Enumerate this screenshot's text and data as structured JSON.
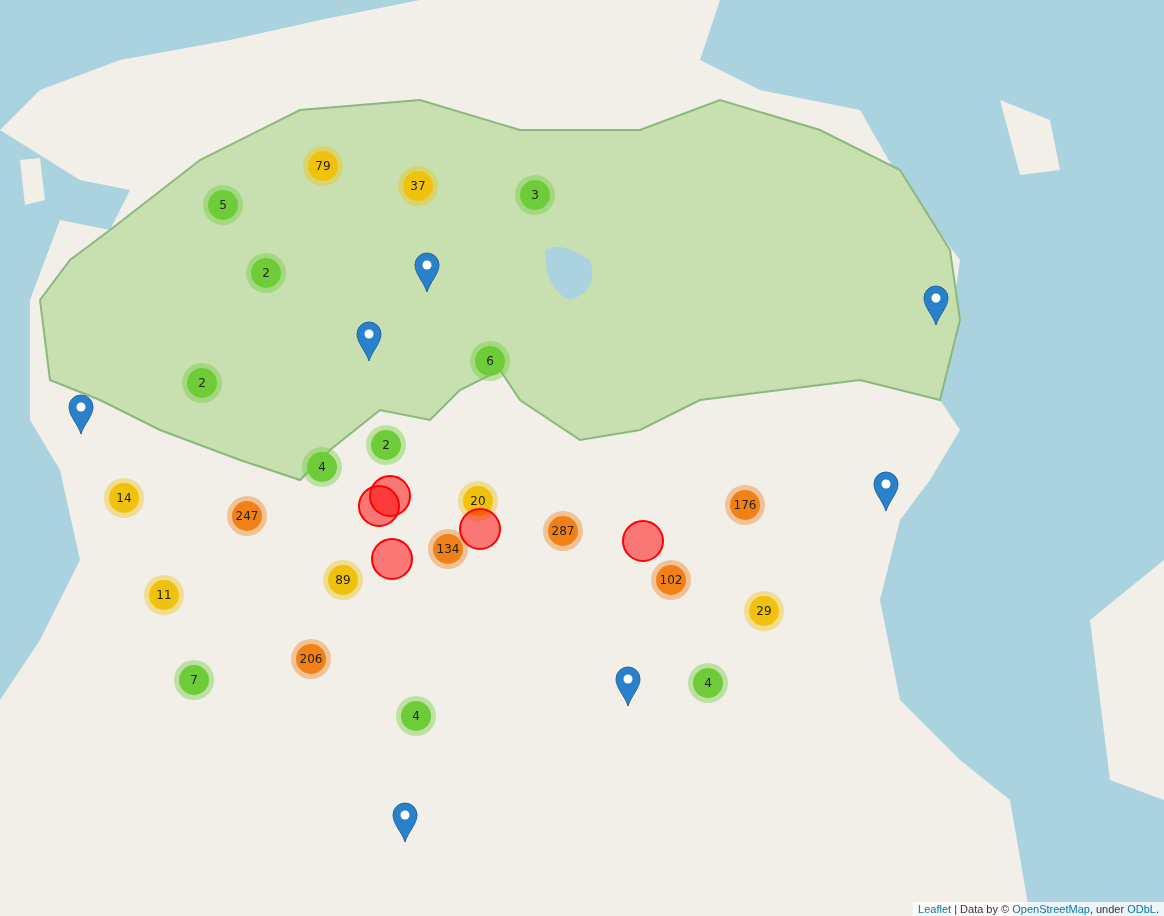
{
  "map": {
    "clusters": [
      {
        "count": "79",
        "color": "#f0c20c"
      },
      {
        "count": "37",
        "color": "#f0c20c"
      },
      {
        "count": "3",
        "color": "#6ecc39"
      },
      {
        "count": "5",
        "color": "#6ecc39"
      },
      {
        "count": "2",
        "color": "#6ecc39"
      },
      {
        "count": "6",
        "color": "#6ecc39"
      },
      {
        "count": "2",
        "color": "#6ecc39"
      },
      {
        "count": "2",
        "color": "#6ecc39"
      },
      {
        "count": "4",
        "color": "#6ecc39"
      },
      {
        "count": "14",
        "color": "#f0c20c"
      },
      {
        "count": "20",
        "color": "#f0c20c"
      },
      {
        "count": "247",
        "color": "#f18017"
      },
      {
        "count": "287",
        "color": "#f18017"
      },
      {
        "count": "176",
        "color": "#f18017"
      },
      {
        "count": "134",
        "color": "#f18017"
      },
      {
        "count": "89",
        "color": "#f0c20c"
      },
      {
        "count": "102",
        "color": "#f18017"
      },
      {
        "count": "11",
        "color": "#f0c20c"
      },
      {
        "count": "29",
        "color": "#f0c20c"
      },
      {
        "count": "206",
        "color": "#f18017"
      },
      {
        "count": "7",
        "color": "#6ecc39"
      },
      {
        "count": "4",
        "color": "#6ecc39"
      },
      {
        "count": "4",
        "color": "#6ecc39"
      }
    ],
    "markers": [
      {
        "kind": "pin"
      },
      {
        "kind": "pin"
      },
      {
        "kind": "pin"
      },
      {
        "kind": "pin"
      },
      {
        "kind": "pin"
      },
      {
        "kind": "pin"
      },
      {
        "kind": "pin"
      }
    ],
    "highlight_circles": [
      {
        "kind": "circle"
      },
      {
        "kind": "circle"
      },
      {
        "kind": "circle"
      },
      {
        "kind": "circle"
      },
      {
        "kind": "circle"
      }
    ]
  },
  "attribution": [
    {
      "kind": "link",
      "text": "Leaflet"
    },
    {
      "kind": "text",
      "text": " | Data by © "
    },
    {
      "kind": "link",
      "text": "OpenStreetMap"
    },
    {
      "kind": "text",
      "text": ", under "
    },
    {
      "kind": "link",
      "text": "ODbL"
    },
    {
      "kind": "text",
      "text": "."
    }
  ]
}
